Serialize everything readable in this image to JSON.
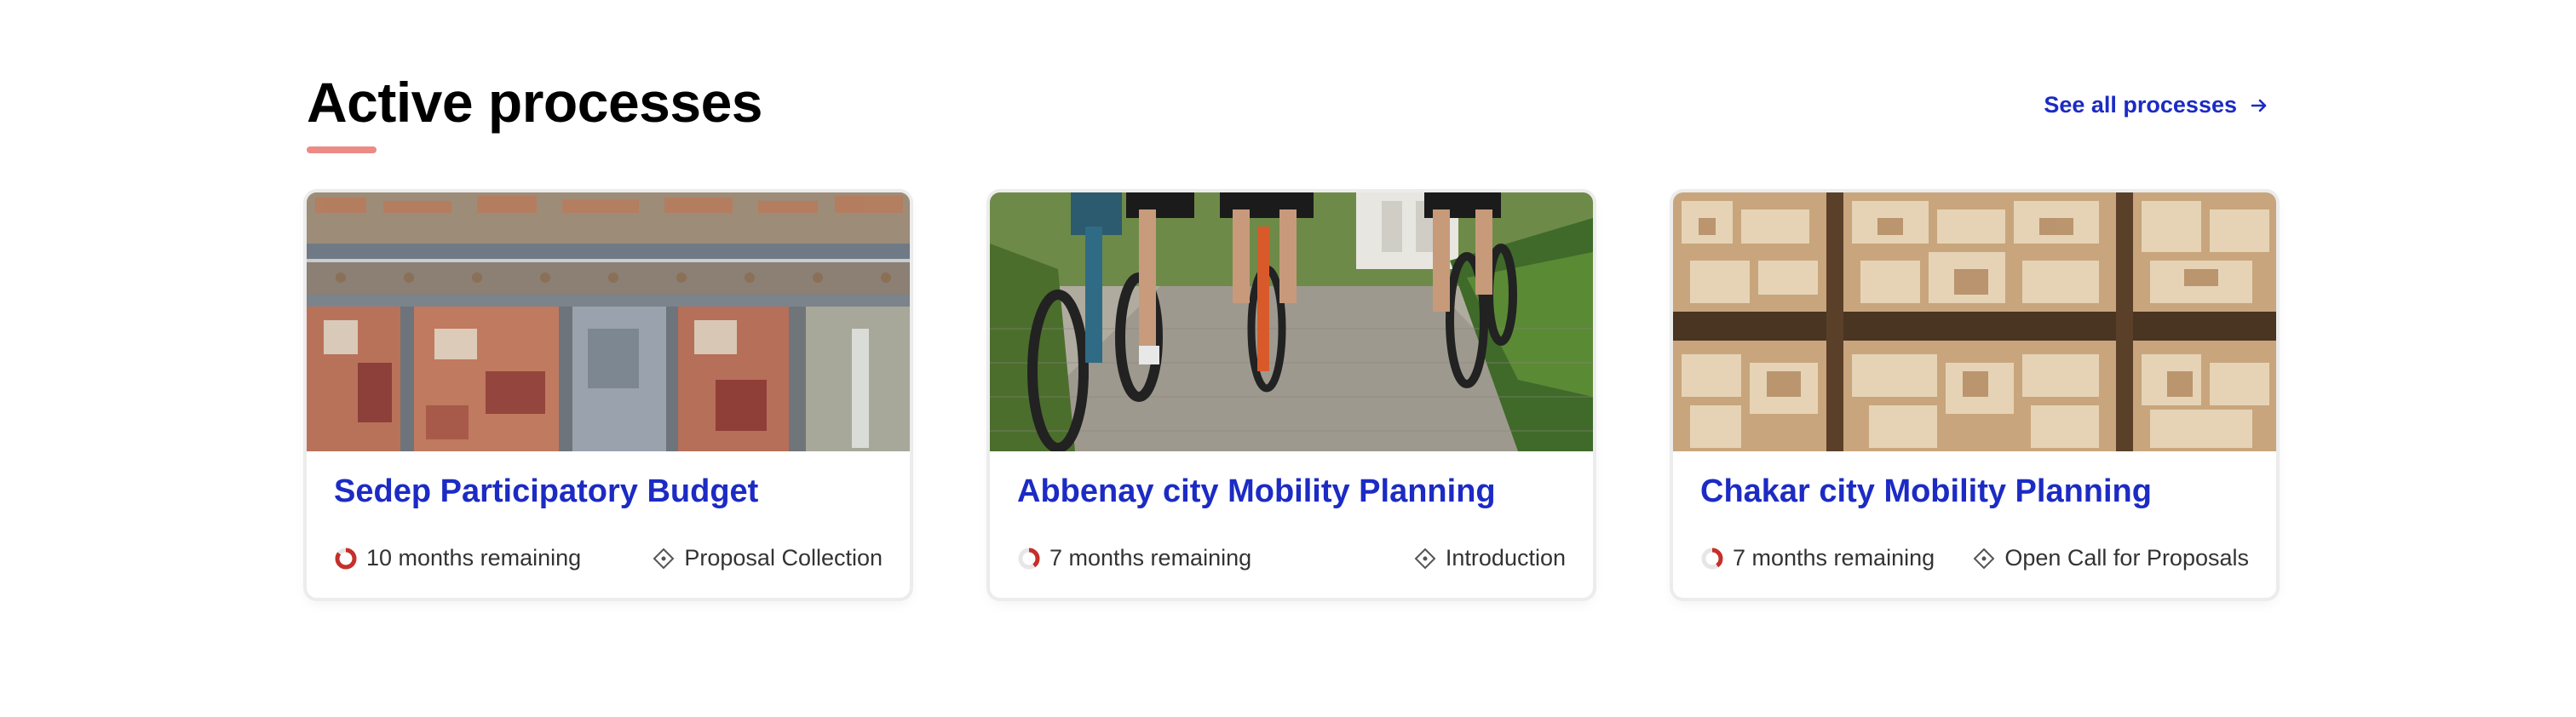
{
  "section": {
    "title": "Active processes",
    "see_all_label": "See all processes",
    "accent_color": "#ec8a86",
    "link_color": "#1c2bc4"
  },
  "cards": [
    {
      "title": "Sedep Participatory Budget",
      "remaining": "10 months remaining",
      "remaining_fraction": 0.85,
      "phase": "Proposal Collection",
      "image": "aerial-city-blocks"
    },
    {
      "title": "Abbenay city Mobility Planning",
      "remaining": "7 months remaining",
      "remaining_fraction": 0.4,
      "phase": "Introduction",
      "image": "cyclists-on-cobblestone-path"
    },
    {
      "title": "Chakar city Mobility Planning",
      "remaining": "7 months remaining",
      "remaining_fraction": 0.4,
      "phase": "Open Call for Proposals",
      "image": "aerial-desert-city"
    }
  ],
  "icons": {
    "time": "progress-ring-icon",
    "phase": "diamond-icon",
    "arrow": "arrow-right-icon"
  }
}
